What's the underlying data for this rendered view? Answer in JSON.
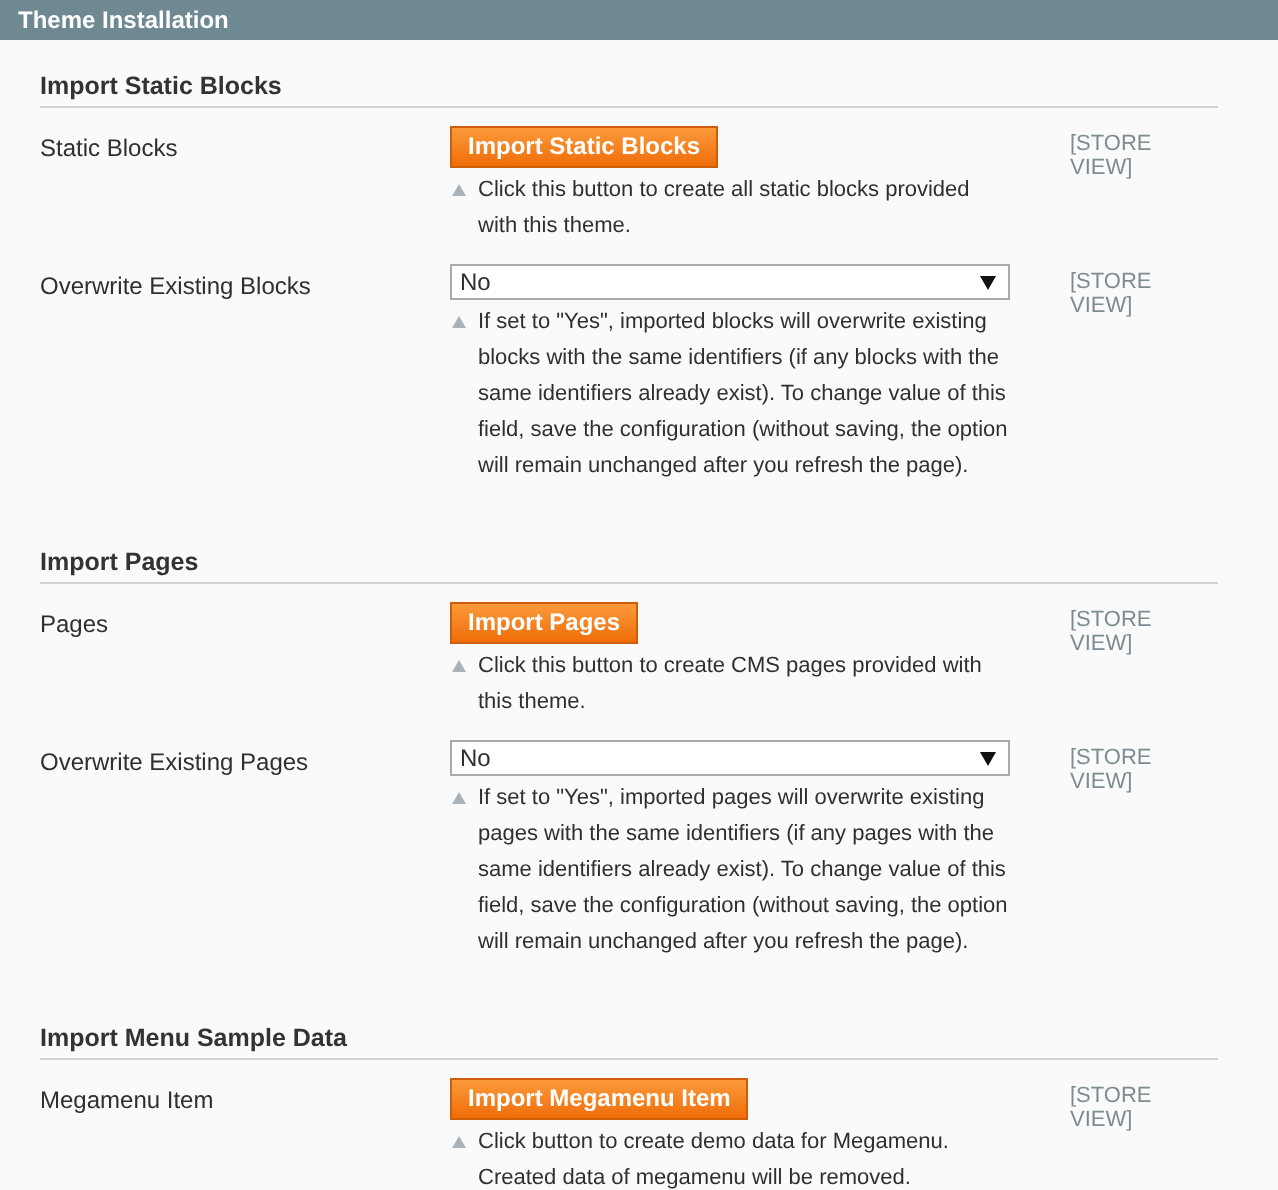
{
  "header": {
    "title": "Theme Installation"
  },
  "sections": [
    {
      "title": "Import Static Blocks",
      "rows": [
        {
          "label": "Static Blocks",
          "kind": "button",
          "button": "Import Static Blocks",
          "scope": "[STORE VIEW]",
          "note": [
            "Click this button to create all static blocks provided with this theme."
          ]
        },
        {
          "label": "Overwrite Existing Blocks",
          "kind": "select",
          "value": "No",
          "scope": "[STORE VIEW]",
          "note": [
            "If set to \"Yes\", imported blocks will overwrite existing blocks with the same identifiers (if any blocks with the same identifiers already exist). To change value of this field, save the configuration (without saving, the option will remain unchanged after you refresh the page)."
          ]
        }
      ]
    },
    {
      "title": "Import Pages",
      "rows": [
        {
          "label": "Pages",
          "kind": "button",
          "button": "Import Pages",
          "scope": "[STORE VIEW]",
          "note": [
            "Click this button to create CMS pages provided with this theme."
          ]
        },
        {
          "label": "Overwrite Existing Pages",
          "kind": "select",
          "value": "No",
          "scope": "[STORE VIEW]",
          "note": [
            "If set to \"Yes\", imported pages will overwrite existing pages with the same identifiers (if any pages with the same identifiers already exist). To change value of this field, save the configuration (without saving, the option will remain unchanged after you refresh the page)."
          ]
        }
      ]
    },
    {
      "title": "Import Menu Sample Data",
      "rows": [
        {
          "label": "Megamenu Item",
          "kind": "button",
          "button": "Import Megamenu Item",
          "scope": "[STORE VIEW]",
          "note": [
            "Click button to create demo data for Megamenu.",
            "Created data of megamenu will be removed."
          ]
        }
      ]
    }
  ]
}
